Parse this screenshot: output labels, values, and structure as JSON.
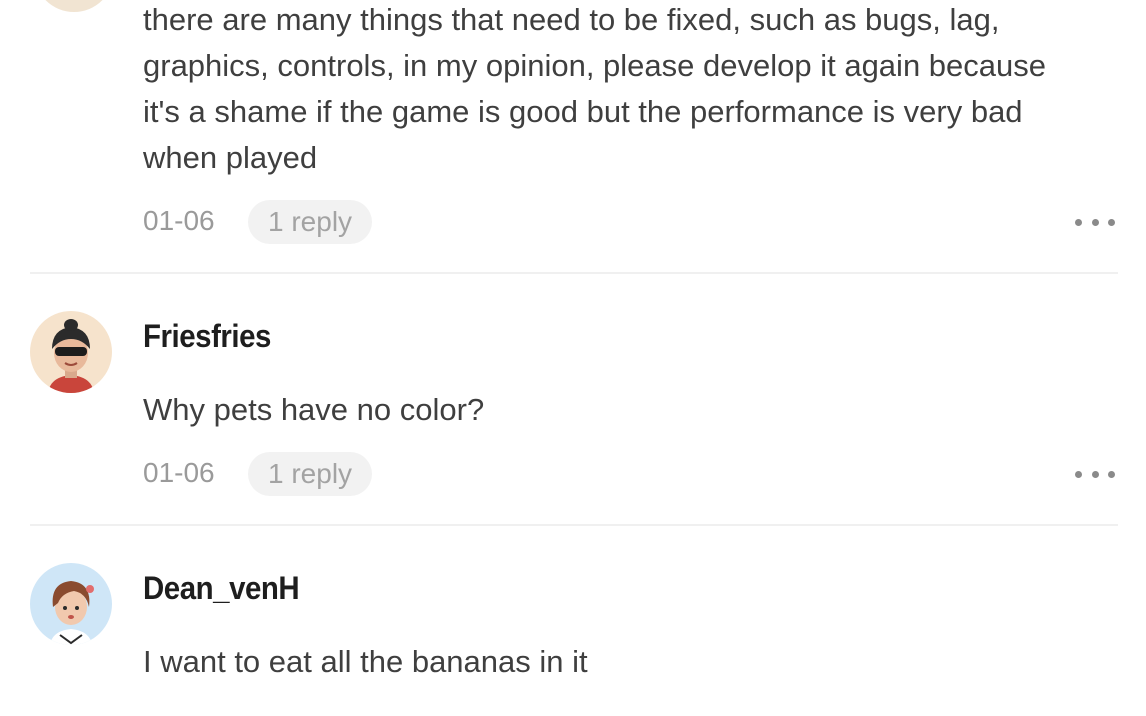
{
  "comments": [
    {
      "text": "there are many things that need to be fixed, such as bugs, lag, graphics, controls, in my opinion, please develop it again because it's a shame if the game is good but the performance is very bad when played",
      "date": "01-06",
      "replies": "1 reply",
      "more_icon": "more-horizontal-icon"
    },
    {
      "author": "Friesfries",
      "text": "Why pets have no color?",
      "date": "01-06",
      "replies": "1 reply",
      "more_icon": "more-horizontal-icon",
      "avatar_bg": "#f6e3cc"
    },
    {
      "author": "Dean_venH",
      "text": "I want to eat all the bananas in it",
      "avatar_bg": "#cfe6f7"
    }
  ],
  "colors": {
    "text": "#3f3f3f",
    "author": "#1e1e1e",
    "meta": "#9a9a9a",
    "pill_bg": "#f2f2f2",
    "divider": "#f0f0f0"
  }
}
